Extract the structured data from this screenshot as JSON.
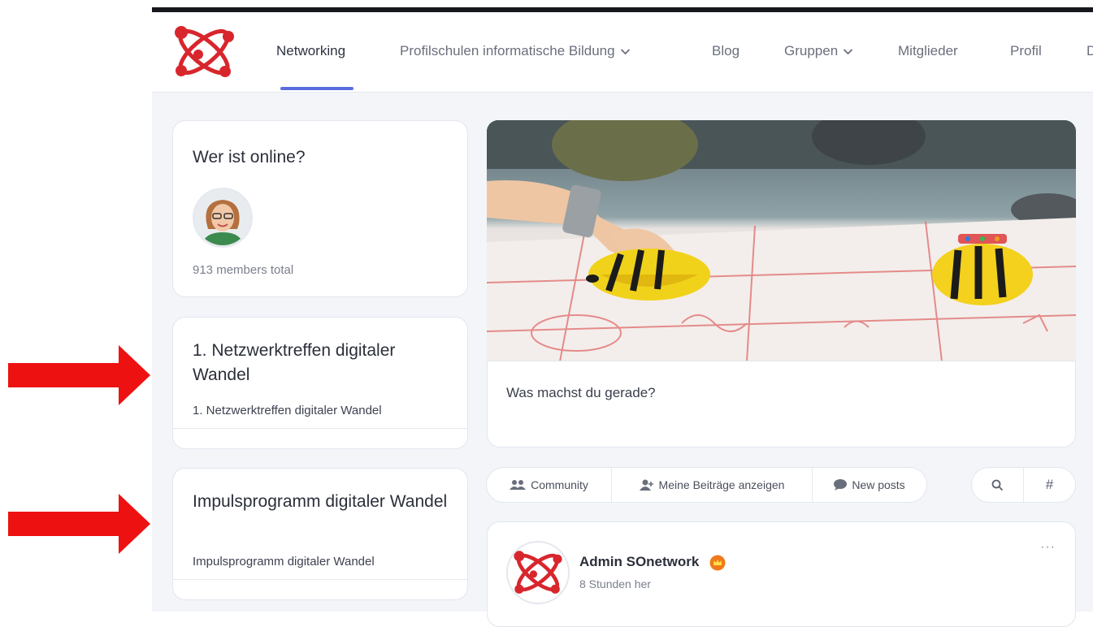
{
  "nav": {
    "items": [
      {
        "label": "Networking",
        "active": true,
        "dropdown": false
      },
      {
        "label": "Profilschulen informatische Bildung",
        "active": false,
        "dropdown": true
      },
      {
        "label": "Blog",
        "active": false,
        "dropdown": false
      },
      {
        "label": "Gruppen",
        "active": false,
        "dropdown": true
      },
      {
        "label": "Mitglieder",
        "active": false,
        "dropdown": false
      },
      {
        "label": "Profil",
        "active": false,
        "dropdown": false
      },
      {
        "label": "D",
        "active": false,
        "dropdown": false
      }
    ],
    "accent_color": "#5a6ee0"
  },
  "sidebar": {
    "online": {
      "title": "Wer ist online?",
      "members_total": "913 members total"
    },
    "group1": {
      "title": "1. Netzwerktreffen digitaler Wandel",
      "subtitle": "1. Netzwerktreffen digitaler Wandel"
    },
    "group2": {
      "title": "Impulsprogramm digitaler Wandel",
      "subtitle": "Impulsprogramm digitaler Wandel"
    }
  },
  "composer": {
    "placeholder": "Was machst du gerade?"
  },
  "filter_tabs": [
    {
      "label": "Community",
      "icon": "users-icon"
    },
    {
      "label": "Meine Beiträge anzeigen",
      "icon": "user-plus-icon"
    },
    {
      "label": "New posts",
      "icon": "chat-bubble-icon"
    }
  ],
  "tools": [
    {
      "icon": "search-icon",
      "glyph": "⌕"
    },
    {
      "icon": "hashtag-icon",
      "glyph": "#"
    }
  ],
  "post": {
    "author": "Admin SOnetwork",
    "time": "8 Stunden her",
    "more": "···"
  },
  "annotation": {
    "arrow_color": "#ee1111"
  },
  "brand_color": "#d8262d"
}
